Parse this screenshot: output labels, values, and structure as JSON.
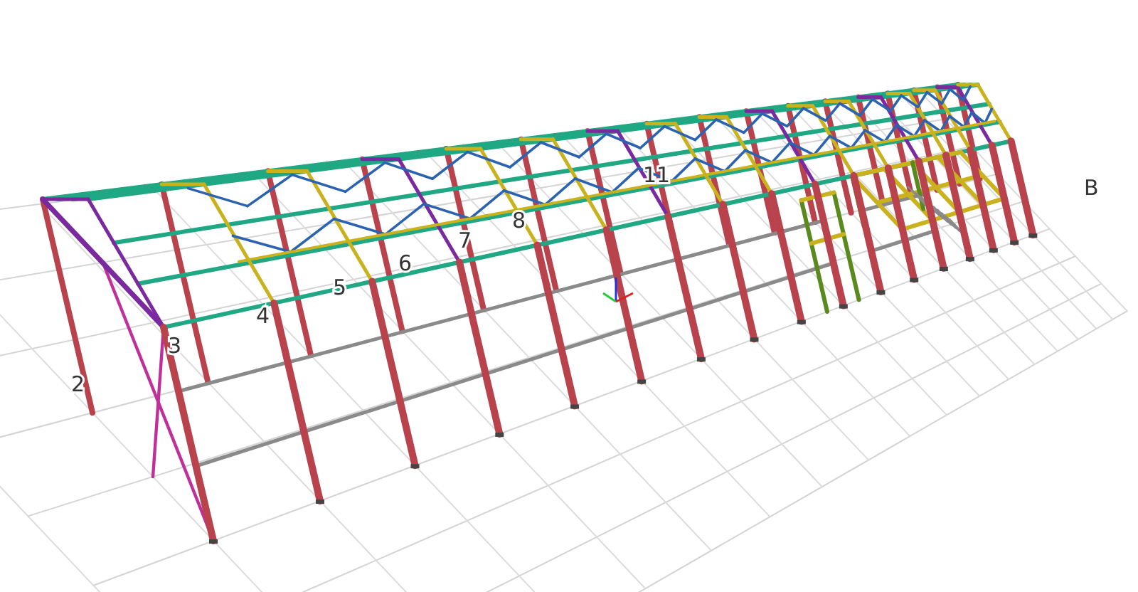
{
  "viewport": {
    "grid_labels": [
      {
        "text": "2"
      },
      {
        "text": "3"
      },
      {
        "text": "4"
      },
      {
        "text": "5"
      },
      {
        "text": "6"
      },
      {
        "text": "7"
      },
      {
        "text": "8"
      },
      {
        "text": "11"
      },
      {
        "text": "B"
      }
    ]
  }
}
